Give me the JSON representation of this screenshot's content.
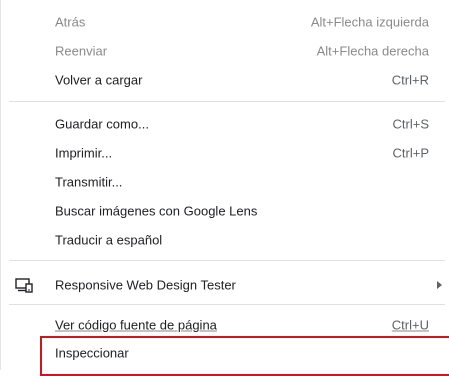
{
  "menu": {
    "back": {
      "label": "Atrás",
      "shortcut": "Alt+Flecha izquierda"
    },
    "forward": {
      "label": "Reenviar",
      "shortcut": "Alt+Flecha derecha"
    },
    "reload": {
      "label": "Volver a cargar",
      "shortcut": "Ctrl+R"
    },
    "save_as": {
      "label": "Guardar como...",
      "shortcut": "Ctrl+S"
    },
    "print": {
      "label": "Imprimir...",
      "shortcut": "Ctrl+P"
    },
    "cast": {
      "label": "Transmitir..."
    },
    "google_lens": {
      "label": "Buscar imágenes con Google Lens"
    },
    "translate": {
      "label": "Traducir a español"
    },
    "extension": {
      "label": "Responsive Web Design Tester",
      "icon": "responsive-devices-icon"
    },
    "view_source": {
      "label": "Ver código fuente de página",
      "shortcut": "Ctrl+U"
    },
    "inspect": {
      "label": "Inspeccionar"
    }
  },
  "colors": {
    "highlight": "#d0151c",
    "text": "#202124",
    "disabled": "#8a8a8a"
  }
}
